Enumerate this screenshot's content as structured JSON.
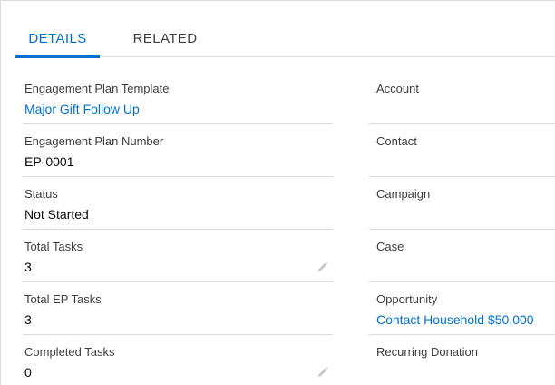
{
  "tabs": [
    {
      "label": "DETAILS",
      "active": true
    },
    {
      "label": "RELATED",
      "active": false
    }
  ],
  "left_fields": [
    {
      "label": "Engagement Plan Template",
      "value": "Major Gift Follow Up",
      "link": true,
      "editable": false
    },
    {
      "label": "Engagement Plan Number",
      "value": "EP-0001",
      "link": false,
      "editable": false
    },
    {
      "label": "Status",
      "value": "Not Started",
      "link": false,
      "editable": false
    },
    {
      "label": "Total Tasks",
      "value": "3",
      "link": false,
      "editable": true
    },
    {
      "label": "Total EP Tasks",
      "value": "3",
      "link": false,
      "editable": false
    },
    {
      "label": "Completed Tasks",
      "value": "0",
      "link": false,
      "editable": true
    }
  ],
  "right_fields": [
    {
      "label": "Account",
      "value": "",
      "link": false
    },
    {
      "label": "Contact",
      "value": "",
      "link": false
    },
    {
      "label": "Campaign",
      "value": "",
      "link": false
    },
    {
      "label": "Case",
      "value": "",
      "link": false
    },
    {
      "label": "Opportunity",
      "value": "Contact Household $50,000",
      "link": true
    },
    {
      "label": "Recurring Donation",
      "value": "",
      "link": false
    }
  ],
  "colors": {
    "accent": "#0070d2",
    "border": "#dddbda",
    "label": "#3e3e3c",
    "icon": "#c9c7c5"
  },
  "icons": {
    "edit": "pencil-icon"
  }
}
